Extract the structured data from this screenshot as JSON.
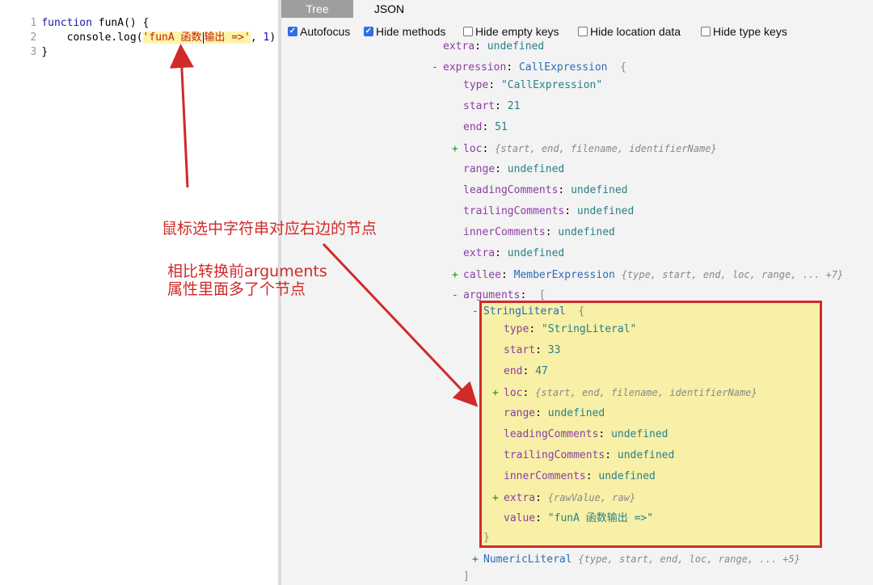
{
  "editor": {
    "lines": [
      {
        "num": "1",
        "kw": "function",
        "name": " funA",
        "rest": "() {"
      },
      {
        "num": "2",
        "pre": "    console.log(",
        "str_a": "'funA 函数",
        "str_b": "输出 =>'",
        "post": ", ",
        "numv": "1",
        "close": ")"
      },
      {
        "num": "3",
        "text": "}"
      }
    ]
  },
  "tabs": {
    "tree": "Tree",
    "json": "JSON"
  },
  "options": [
    {
      "label": "Autofocus",
      "checked": true
    },
    {
      "label": "Hide methods",
      "checked": true
    },
    {
      "label": "Hide empty keys",
      "checked": false
    },
    {
      "label": "Hide location data",
      "checked": false
    },
    {
      "label": "Hide type keys",
      "checked": false
    }
  ],
  "tree": {
    "r0": {
      "key": "extra",
      "val": "undefined"
    },
    "r1": {
      "key": "expression",
      "type": "CallExpression",
      "brace": "{"
    },
    "r2": {
      "key": "type",
      "val": "\"CallExpression\""
    },
    "r3": {
      "key": "start",
      "val": "21"
    },
    "r4": {
      "key": "end",
      "val": "51"
    },
    "r5": {
      "key": "loc",
      "summary": "{start, end, filename, identifierName}"
    },
    "r6": {
      "key": "range",
      "val": "undefined"
    },
    "r7": {
      "key": "leadingComments",
      "val": "undefined"
    },
    "r8": {
      "key": "trailingComments",
      "val": "undefined"
    },
    "r9": {
      "key": "innerComments",
      "val": "undefined"
    },
    "r10": {
      "key": "extra",
      "val": "undefined"
    },
    "r11": {
      "key": "callee",
      "type": "MemberExpression",
      "summary": "{type, start, end, loc, range, ... +7}"
    },
    "r12": {
      "key": "arguments",
      "brace": "["
    },
    "r13": {
      "type": "StringLiteral",
      "brace": "{"
    },
    "r14": {
      "key": "type",
      "val": "\"StringLiteral\""
    },
    "r15": {
      "key": "start",
      "val": "33"
    },
    "r16": {
      "key": "end",
      "val": "47"
    },
    "r17": {
      "key": "loc",
      "summary": "{start, end, filename, identifierName}"
    },
    "r18": {
      "key": "range",
      "val": "undefined"
    },
    "r19": {
      "key": "leadingComments",
      "val": "undefined"
    },
    "r20": {
      "key": "trailingComments",
      "val": "undefined"
    },
    "r21": {
      "key": "innerComments",
      "val": "undefined"
    },
    "r22": {
      "key": "extra",
      "summary": "{rawValue, raw}"
    },
    "r23": {
      "key": "value",
      "val": "\"funA 函数输出 =>\""
    },
    "r24": {
      "brace": "}"
    },
    "r25": {
      "type": "NumericLiteral",
      "summary": "{type, start, end, loc, range, ... +5}"
    },
    "r26": {
      "brace": "]"
    }
  },
  "annotations": {
    "a1": "鼠标选中字符串对应右边的节点",
    "a2_line1": "相比转换前arguments",
    "a2_line2": "属性里面多了个节点"
  },
  "colors": {
    "annotation": "#d12a2a",
    "highlight": "#f7f0a6"
  }
}
